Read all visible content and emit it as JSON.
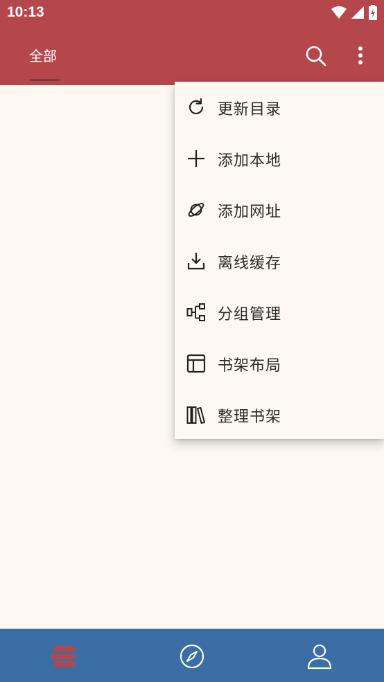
{
  "status_bar": {
    "time": "10:13"
  },
  "toolbar": {
    "tab_all": "全部"
  },
  "menu": {
    "items": [
      {
        "label": "更新目录",
        "icon": "refresh-icon"
      },
      {
        "label": "添加本地",
        "icon": "plus-icon"
      },
      {
        "label": "添加网址",
        "icon": "planet-icon"
      },
      {
        "label": "离线缓存",
        "icon": "download-icon"
      },
      {
        "label": "分组管理",
        "icon": "group-icon"
      },
      {
        "label": "书架布局",
        "icon": "layout-icon"
      },
      {
        "label": "整理书架",
        "icon": "books-icon"
      }
    ]
  },
  "bottom_nav": {
    "items": [
      {
        "icon": "bookshelf-icon",
        "active": true
      },
      {
        "icon": "compass-icon",
        "active": false
      },
      {
        "icon": "user-icon",
        "active": false
      }
    ]
  },
  "colors": {
    "primary": "#b5474c",
    "bottom_nav": "#3b6ea4",
    "background": "#fdf8f2",
    "active_icon": "#b5474c"
  }
}
